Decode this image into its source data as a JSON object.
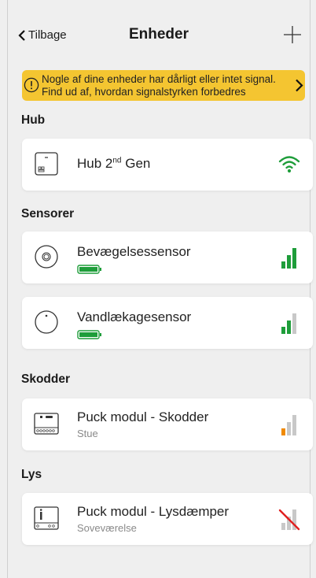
{
  "header": {
    "back_label": "Tilbage",
    "title": "Enheder",
    "add_icon": "plus-icon"
  },
  "warning": {
    "line1": "Nogle af dine enheder har dårligt eller intet signal.",
    "line2": "Find ud af, hvordan signalstyrken forbedres",
    "color": "#f4c531",
    "icon": "info-circle-icon"
  },
  "sections": {
    "hub": "Hub",
    "sensors": "Sensorer",
    "shutters": "Skodder",
    "lights": "Lys"
  },
  "devices": {
    "hub": {
      "name_main": "Hub 2",
      "name_sup": "nd",
      "name_tail": " Gen",
      "signal": "wifi-full"
    },
    "motion": {
      "name": "Bevægelsessensor",
      "battery": "full",
      "signal_level": 3,
      "signal_color": "#1e9d3a"
    },
    "leak": {
      "name": "Vandlækagesensor",
      "battery": "full",
      "signal_level": 2,
      "signal_color": "#1e9d3a"
    },
    "shutter": {
      "name": "Puck modul - Skodder",
      "room": "Stue",
      "signal_level": 1,
      "signal_color": "#f08a00"
    },
    "dimmer": {
      "name": "Puck modul - Lysdæmper",
      "room": "Soveværelse",
      "signal_level": 0,
      "signal_color": "#e02020"
    }
  },
  "colors": {
    "background": "#efefef",
    "signal_good": "#1e9d3a",
    "signal_weak": "#f08a00",
    "signal_none": "#e02020",
    "inactive_bar": "#c8c8c8"
  }
}
